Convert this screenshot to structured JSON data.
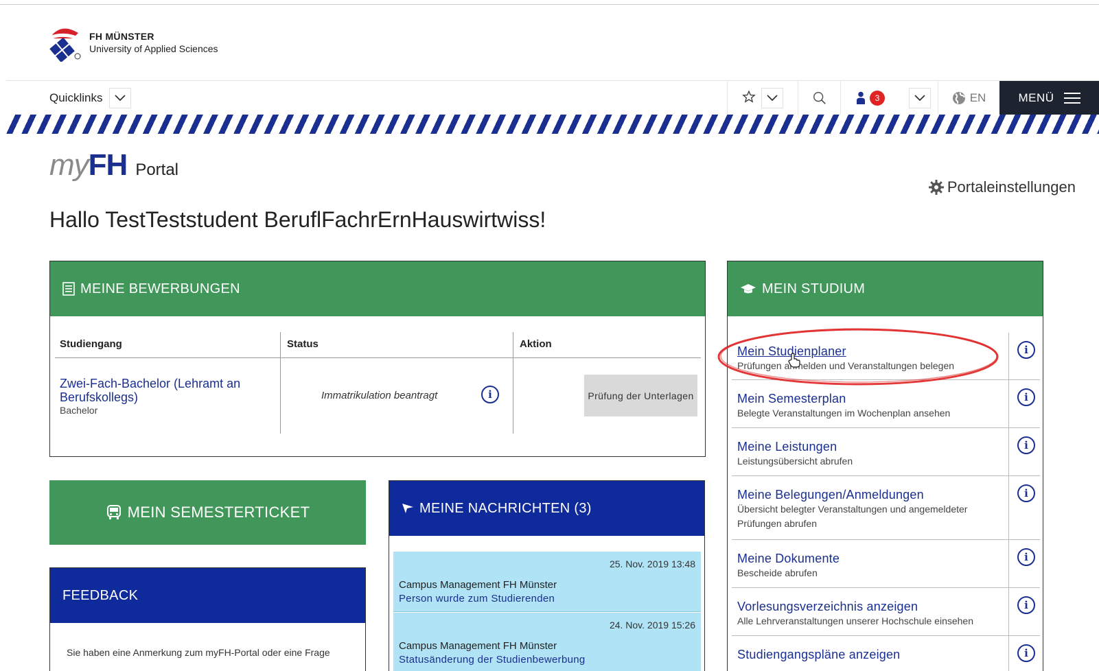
{
  "header": {
    "logo_name": "FH MÜNSTER",
    "logo_subtitle": "University of Applied Sciences"
  },
  "nav": {
    "quicklinks_label": "Quicklinks",
    "notification_count": "3",
    "language_label": "EN",
    "menu_label": "MENÜ"
  },
  "portal": {
    "brand_my": "my",
    "brand_fh": "FH",
    "brand_portal": "Portal",
    "settings_label": "Portaleinstellungen",
    "greeting": "Hallo TestTeststudent BeruflFachrErnHauswirtwiss!"
  },
  "bewerbungen": {
    "title": "MEINE BEWERBUNGEN",
    "columns": [
      "Studiengang",
      "Status",
      "Aktion"
    ],
    "rows": [
      {
        "program": "Zwei-Fach-Bachelor (Lehramt an Berufskollegs)",
        "degree": "Bachelor",
        "status": "Immatrikulation beantragt",
        "action": "Prüfung der Unterlagen"
      }
    ]
  },
  "semesterticket": {
    "title": "MEIN SEMESTERTICKET"
  },
  "feedback": {
    "title": "FEEDBACK",
    "text": "Sie haben eine Anmerkung zum myFH-Portal oder eine Frage"
  },
  "nachrichten": {
    "title": "MEINE NACHRICHTEN (3)",
    "items": [
      {
        "date": "25. Nov. 2019 13:48",
        "sender": "Campus Management FH Münster",
        "subject": "Person wurde zum Studierenden"
      },
      {
        "date": "24. Nov. 2019 15:26",
        "sender": "Campus Management FH Münster",
        "subject": "Statusänderung der Studienbewerbung"
      }
    ]
  },
  "studium": {
    "title": "MEIN STUDIUM",
    "items": [
      {
        "title": "Mein Studienplaner",
        "desc": "Prüfungen anmelden und Veranstaltungen belegen"
      },
      {
        "title": "Mein Semesterplan",
        "desc": "Belegte Veranstaltungen im Wochenplan ansehen"
      },
      {
        "title": "Meine Leistungen",
        "desc": "Leistungsübersicht abrufen"
      },
      {
        "title": "Meine Belegungen/Anmeldungen",
        "desc": "Übersicht belegter Veranstaltungen und angemeldeter Prüfungen abrufen"
      },
      {
        "title": "Meine Dokumente",
        "desc": "Bescheide abrufen"
      },
      {
        "title": "Vorlesungsverzeichnis anzeigen",
        "desc": "Alle Lehrveranstaltungen unserer Hochschule einsehen"
      },
      {
        "title": "Studiengangspläne anzeigen",
        "desc": ""
      }
    ]
  },
  "colors": {
    "green": "#41975a",
    "blue": "#0f2a9a",
    "link": "#1a2f8f",
    "highlight_ring": "#e02424"
  }
}
